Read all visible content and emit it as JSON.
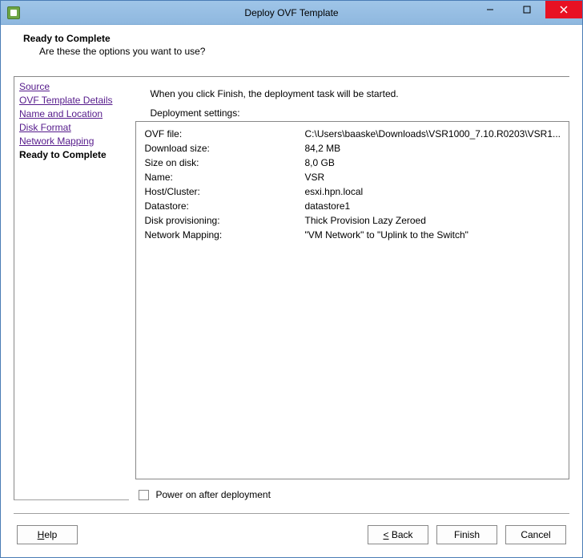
{
  "titlebar": {
    "title": "Deploy OVF Template"
  },
  "header": {
    "title": "Ready to Complete",
    "subtitle": "Are these the options you want to use?"
  },
  "sidebar": {
    "items": [
      {
        "label": "Source"
      },
      {
        "label": "OVF Template Details"
      },
      {
        "label": "Name and Location"
      },
      {
        "label": "Disk Format"
      },
      {
        "label": "Network Mapping"
      }
    ],
    "current": "Ready to Complete"
  },
  "content": {
    "intro": "When you click Finish, the deployment task will be started.",
    "settings_label": "Deployment settings:",
    "settings": [
      {
        "key": "OVF file:",
        "value": "C:\\Users\\baaske\\Downloads\\VSR1000_7.10.R0203\\VSR1..."
      },
      {
        "key": "Download size:",
        "value": "84,2 MB"
      },
      {
        "key": "Size on disk:",
        "value": "8,0 GB"
      },
      {
        "key": "Name:",
        "value": "VSR"
      },
      {
        "key": "Host/Cluster:",
        "value": "esxi.hpn.local"
      },
      {
        "key": "Datastore:",
        "value": "datastore1"
      },
      {
        "key": "Disk provisioning:",
        "value": "Thick Provision Lazy Zeroed"
      },
      {
        "key": "Network Mapping:",
        "value": "\"VM Network\" to \"Uplink to the Switch\""
      }
    ],
    "checkbox_label": "Power on after deployment",
    "checkbox_checked": false
  },
  "buttons": {
    "help": "Help",
    "back": "< Back",
    "finish": "Finish",
    "cancel": "Cancel"
  }
}
